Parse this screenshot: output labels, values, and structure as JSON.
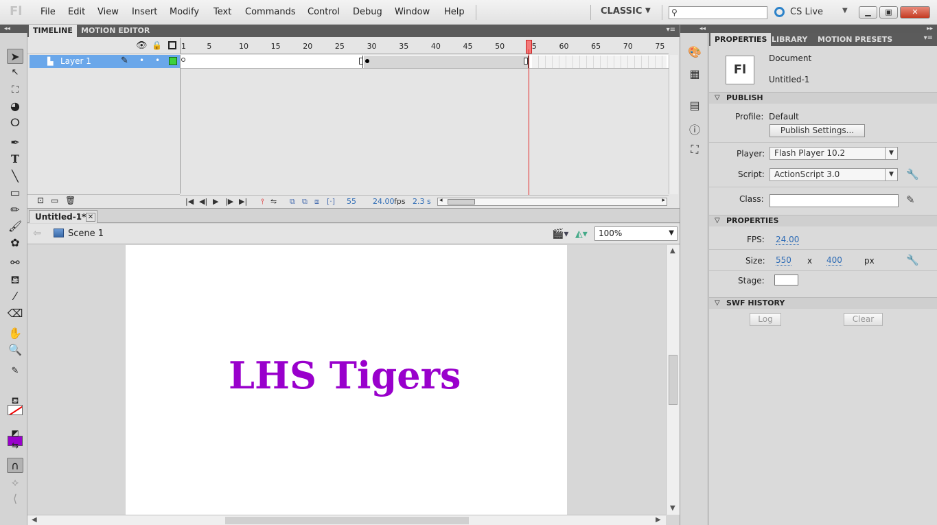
{
  "app": {
    "logo": "Fl"
  },
  "menu": [
    "File",
    "Edit",
    "View",
    "Insert",
    "Modify",
    "Text",
    "Commands",
    "Control",
    "Debug",
    "Window",
    "Help"
  ],
  "workspace": {
    "label": "CLASSIC"
  },
  "cslive": {
    "label": "CS Live"
  },
  "timeline": {
    "tabs": [
      "TIMELINE",
      "MOTION EDITOR"
    ],
    "layer_name": "Layer 1",
    "ruler": [
      "1",
      "5",
      "10",
      "15",
      "20",
      "25",
      "30",
      "35",
      "40",
      "45",
      "50",
      "55",
      "60",
      "65",
      "70",
      "75"
    ],
    "current_frame": "55",
    "fps": "24.00",
    "fps_unit": "fps",
    "time": "2.3 s"
  },
  "document": {
    "tab": "Untitled-1*",
    "scene": "Scene 1",
    "zoom": "100%",
    "stage_text": "LHS Tigers",
    "stage_text_color": "#9900cc"
  },
  "tools": {
    "fill_color": "#9900cc"
  },
  "properties": {
    "tabs": [
      "PROPERTIES",
      "LIBRARY",
      "MOTION PRESETS"
    ],
    "doc_icon": "Fl",
    "doc_type": "Document",
    "doc_name": "Untitled-1",
    "publish": {
      "header": "PUBLISH",
      "profile_label": "Profile:",
      "profile_value": "Default",
      "settings_button": "Publish Settings...",
      "player_label": "Player:",
      "player_value": "Flash Player 10.2",
      "script_label": "Script:",
      "script_value": "ActionScript 3.0",
      "class_label": "Class:"
    },
    "props": {
      "header": "PROPERTIES",
      "fps_label": "FPS:",
      "fps_value": "24.00",
      "size_label": "Size:",
      "width": "550",
      "x": "x",
      "height": "400",
      "unit": "px",
      "stage_label": "Stage:"
    },
    "swf": {
      "header": "SWF HISTORY",
      "log_button": "Log",
      "clear_button": "Clear"
    }
  }
}
